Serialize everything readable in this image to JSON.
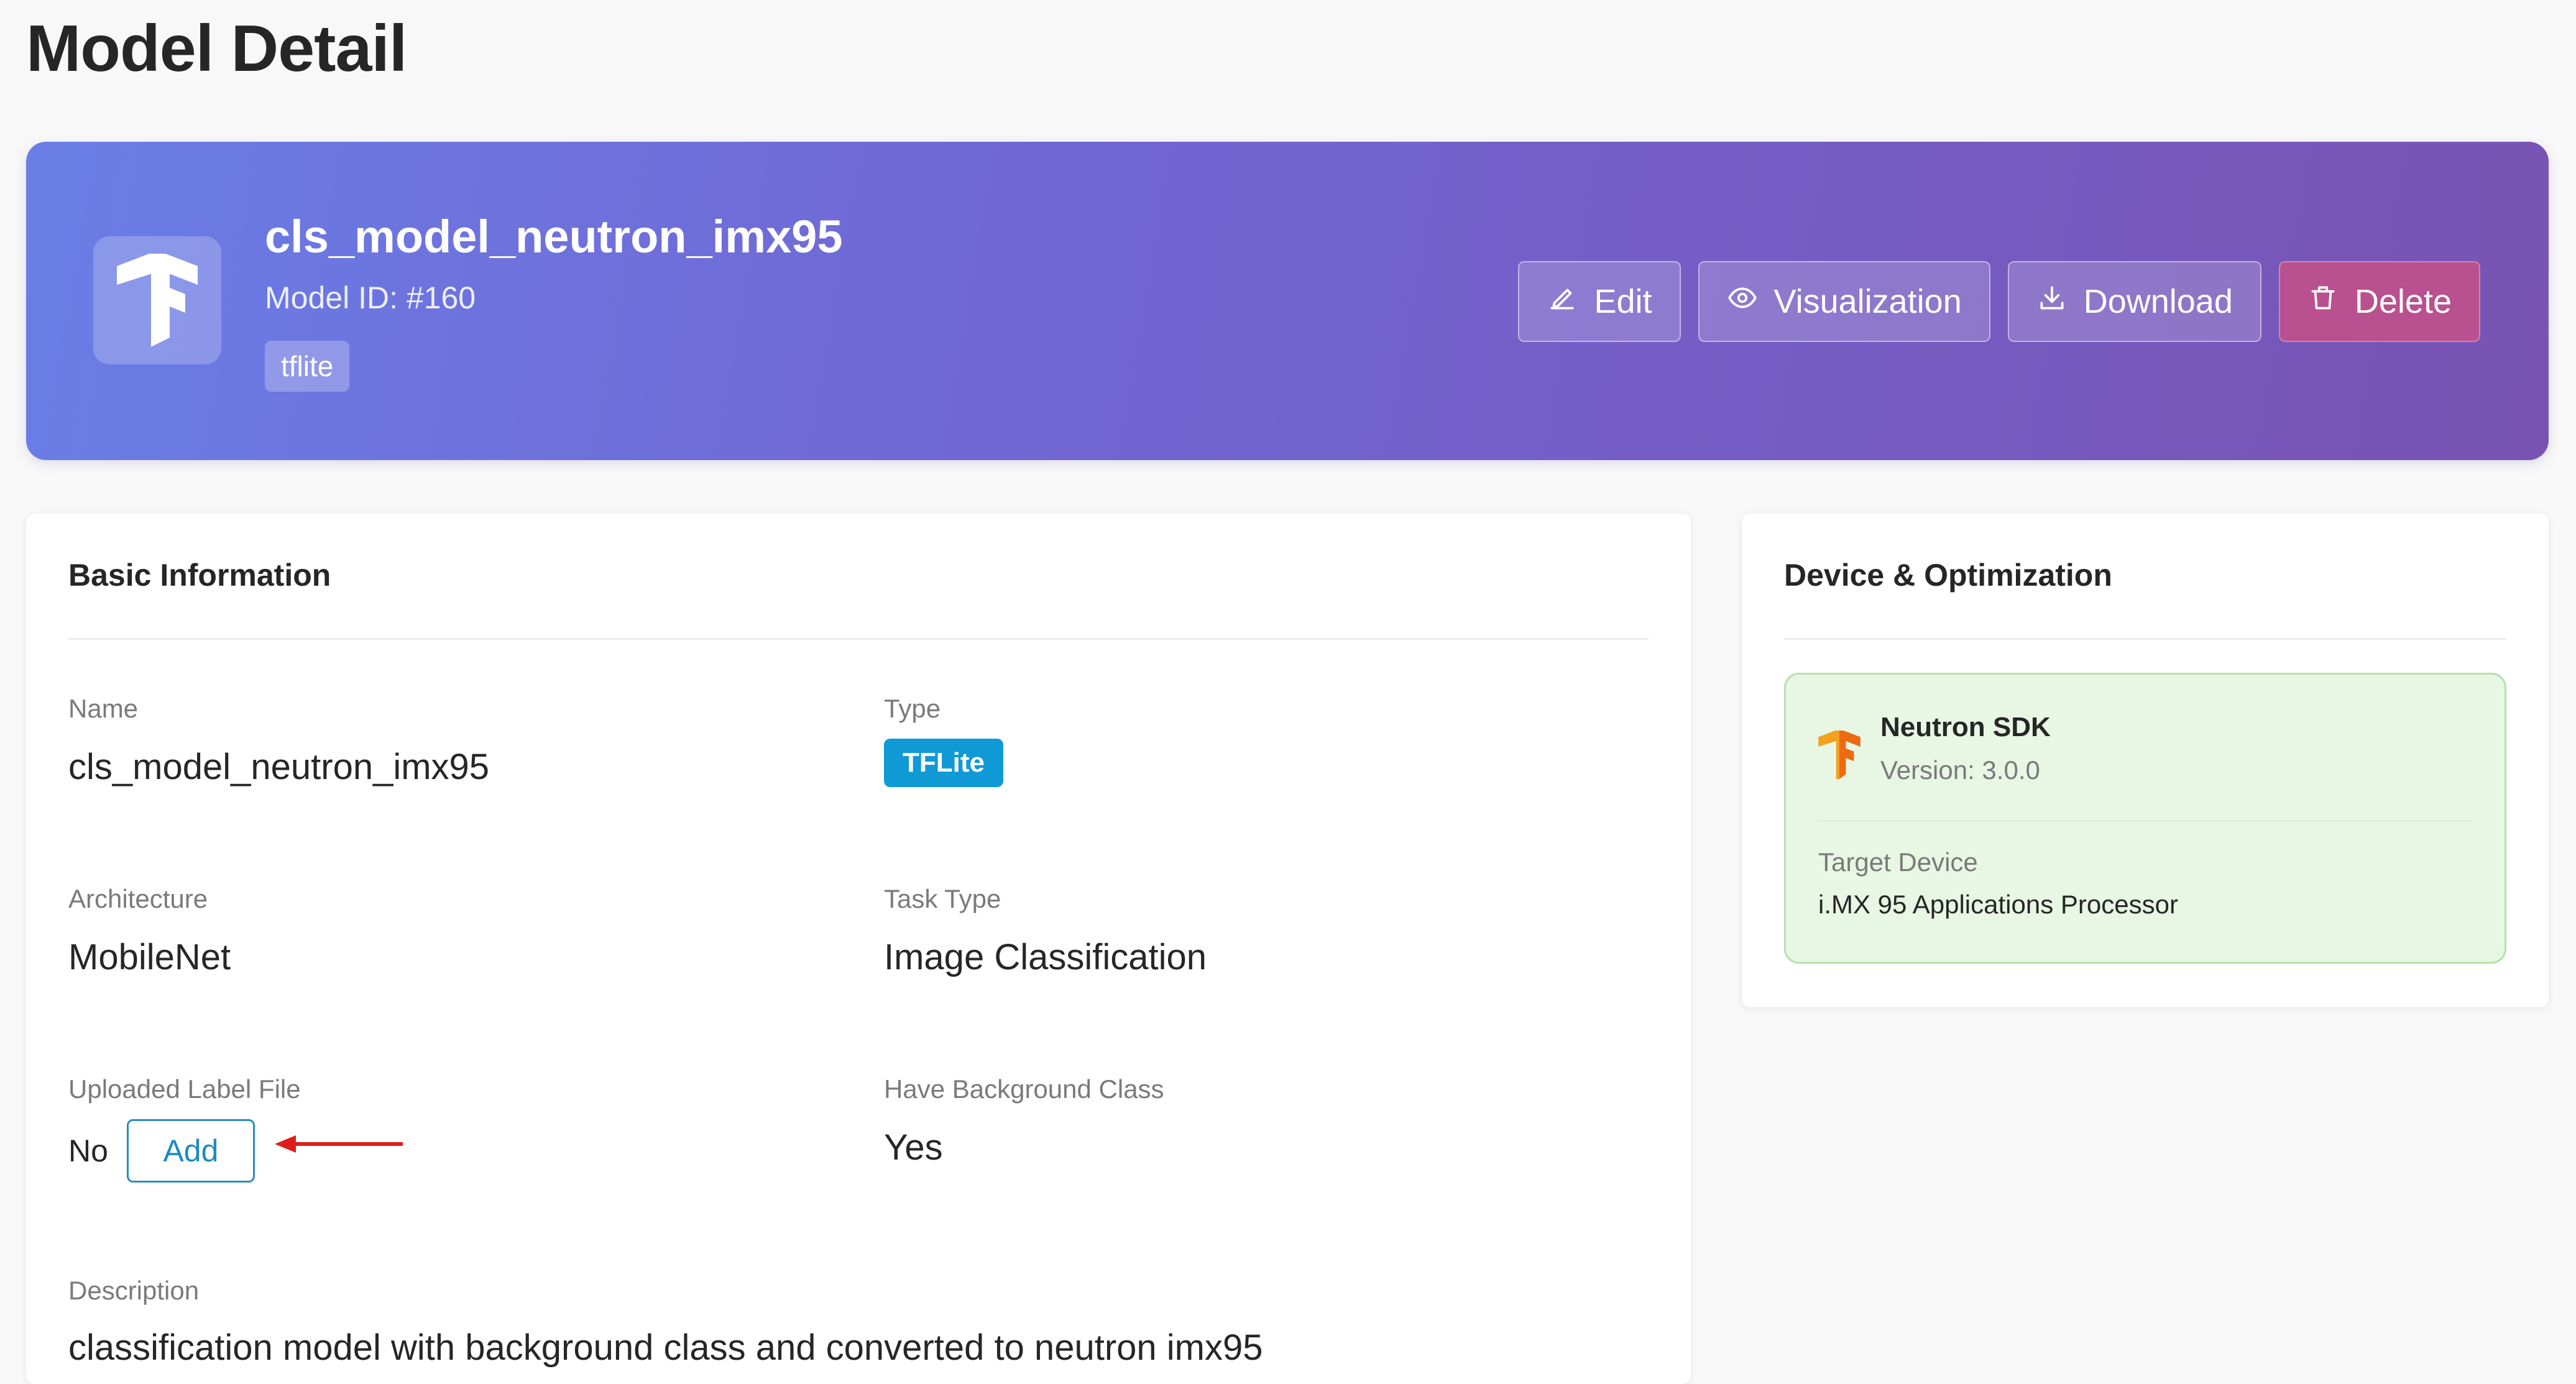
{
  "page": {
    "title": "Model Detail"
  },
  "hero": {
    "model_name": "cls_model_neutron_imx95",
    "model_id": "Model ID: #160",
    "format_tag": "tflite",
    "actions": {
      "edit": "Edit",
      "visualization": "Visualization",
      "download": "Download",
      "delete": "Delete"
    }
  },
  "basic_info": {
    "title": "Basic Information",
    "name_label": "Name",
    "name_value": "cls_model_neutron_imx95",
    "type_label": "Type",
    "type_value": "TFLite",
    "architecture_label": "Architecture",
    "architecture_value": "MobileNet",
    "task_type_label": "Task Type",
    "task_type_value": "Image Classification",
    "label_file_label": "Uploaded Label File",
    "label_file_value": "No",
    "add_button": "Add",
    "background_class_label": "Have Background Class",
    "background_class_value": "Yes",
    "description_label": "Description",
    "description_value": "classification model with background class and converted to neutron imx95"
  },
  "device": {
    "title": "Device & Optimization",
    "sdk_name": "Neutron SDK",
    "sdk_version": "Version: 3.0.0",
    "target_label": "Target Device",
    "target_value": "i.MX 95 Applications Processor"
  },
  "colors": {
    "hero_gradient_start": "#6a7ee6",
    "hero_gradient_end": "#7853b3",
    "type_badge": "#0f9ad6",
    "sdk_box_bg": "#e8f6e4",
    "delete_button": "#b9508f",
    "arrow": "#e01b1b"
  },
  "icons": {
    "model_logo": "tensorflow-icon",
    "edit": "pencil-icon",
    "visualization": "eye-icon",
    "download": "download-icon",
    "delete": "trash-icon",
    "sdk_logo": "tensorflow-icon"
  }
}
